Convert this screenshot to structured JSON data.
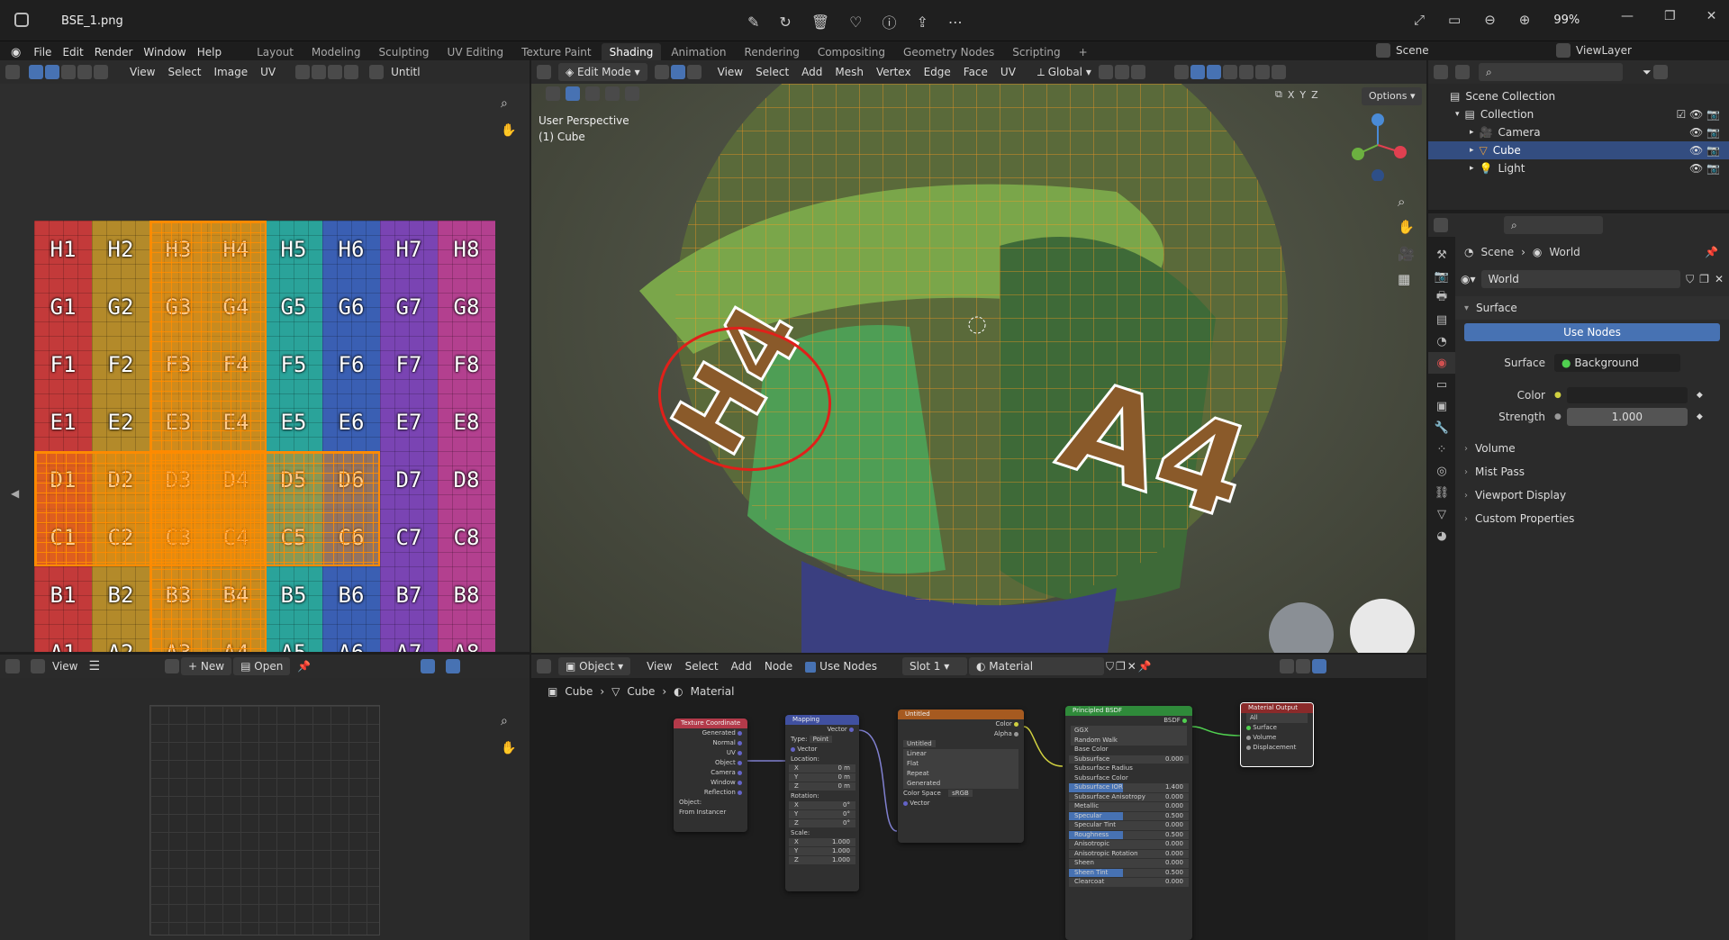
{
  "titlebar": {
    "filename": "BSE_1.png",
    "zoom": "99%"
  },
  "menu": {
    "items": [
      "File",
      "Edit",
      "Render",
      "Window",
      "Help"
    ],
    "workspaces": [
      "Layout",
      "Modeling",
      "Sculpting",
      "UV Editing",
      "Texture Paint",
      "Shading",
      "Animation",
      "Rendering",
      "Compositing",
      "Geometry Nodes",
      "Scripting"
    ],
    "active_workspace": "Shading",
    "scene_label": "Scene",
    "viewlayer_label": "ViewLayer"
  },
  "uv_editor": {
    "menu": [
      "View",
      "Select",
      "Image",
      "UV"
    ],
    "image_name": "Untitl",
    "rows": [
      [
        "H1",
        "H2",
        "H3",
        "H4",
        "H5",
        "H6",
        "H7",
        "H8"
      ],
      [
        "G1",
        "G2",
        "G3",
        "G4",
        "G5",
        "G6",
        "G7",
        "G8"
      ],
      [
        "F1",
        "F2",
        "F3",
        "F4",
        "F5",
        "F6",
        "F7",
        "F8"
      ],
      [
        "E1",
        "E2",
        "E3",
        "E4",
        "E5",
        "E6",
        "E7",
        "E8"
      ],
      [
        "D1",
        "D2",
        "D3",
        "D4",
        "D5",
        "D6",
        "D7",
        "D8"
      ],
      [
        "C1",
        "C2",
        "C3",
        "C4",
        "C5",
        "C6",
        "C7",
        "C8"
      ],
      [
        "B1",
        "B2",
        "B3",
        "B4",
        "B5",
        "B6",
        "B7",
        "B8"
      ],
      [
        "A1",
        "A2",
        "A3",
        "A4",
        "A5",
        "A6",
        "A7",
        "A8"
      ]
    ],
    "column_colors": [
      "#c33a3a",
      "#b38a2a",
      "#a98a33",
      "#9b8a3a",
      "#2aa39a",
      "#3a5fb3",
      "#7a44b3",
      "#b3408f"
    ]
  },
  "viewport": {
    "mode": "Edit Mode",
    "menu": [
      "View",
      "Select",
      "Add",
      "Mesh",
      "Vertex",
      "Edge",
      "Face",
      "UV"
    ],
    "orientation": "Global",
    "perspective": "User Perspective",
    "object": "(1) Cube",
    "options_label": "Options",
    "axes": [
      "X",
      "Y",
      "Z"
    ]
  },
  "image_editor": {
    "view_label": "View",
    "new_label": "New",
    "open_label": "Open"
  },
  "node_editor": {
    "mode": "Object",
    "menu": [
      "View",
      "Select",
      "Add",
      "Node"
    ],
    "use_nodes_label": "Use Nodes",
    "slot": "Slot 1",
    "material": "Material",
    "breadcrumb": [
      "Cube",
      "Cube",
      "Material"
    ],
    "nodes": {
      "texcoord": {
        "title": "Texture Coordinate",
        "outputs": [
          "Generated",
          "Normal",
          "UV",
          "Object",
          "Camera",
          "Window",
          "Reflection"
        ],
        "object_label": "Object:",
        "instancer": "From Instancer"
      },
      "mapping": {
        "title": "Mapping",
        "out": "Vector",
        "type_label": "Type:",
        "type_value": "Point",
        "vector": "Vector",
        "location": "Location:",
        "rotation": "Rotation:",
        "scale": "Scale:",
        "loc": [
          "0 m",
          "0 m",
          "0 m"
        ],
        "rot": [
          "0°",
          "0°",
          "0°"
        ],
        "scl": [
          "1.000",
          "1.000",
          "1.000"
        ],
        "axes": [
          "X",
          "Y",
          "Z"
        ]
      },
      "image": {
        "title": "Untitled",
        "outs": [
          "Color",
          "Alpha"
        ],
        "img": "Untitled",
        "opts": [
          "Linear",
          "Flat",
          "Repeat",
          "Generated"
        ],
        "cs_label": "Color Space",
        "cs_value": "sRGB",
        "vector": "Vector"
      },
      "bsdf": {
        "title": "Principled BSDF",
        "out": "BSDF",
        "dist": "GGX",
        "sss": "Random Walk",
        "rows": [
          [
            "Base Color",
            ""
          ],
          [
            "Subsurface",
            "0.000"
          ],
          [
            "Subsurface Radius",
            ""
          ],
          [
            "Subsurface Color",
            ""
          ],
          [
            "Subsurface IOR",
            "1.400"
          ],
          [
            "Subsurface Anisotropy",
            "0.000"
          ],
          [
            "Metallic",
            "0.000"
          ],
          [
            "Specular",
            "0.500"
          ],
          [
            "Specular Tint",
            "0.000"
          ],
          [
            "Roughness",
            "0.500"
          ],
          [
            "Anisotropic",
            "0.000"
          ],
          [
            "Anisotropic Rotation",
            "0.000"
          ],
          [
            "Sheen",
            "0.000"
          ],
          [
            "Sheen Tint",
            "0.500"
          ],
          [
            "Clearcoat",
            "0.000"
          ]
        ]
      },
      "output": {
        "title": "Material Output",
        "target": "All",
        "inputs": [
          "Surface",
          "Volume",
          "Displacement"
        ]
      }
    }
  },
  "outliner": {
    "root": "Scene Collection",
    "collection": "Collection",
    "items": [
      "Camera",
      "Cube",
      "Light"
    ]
  },
  "properties": {
    "breadcrumb": [
      "Scene",
      "World"
    ],
    "world_name": "World",
    "surface_section": "Surface",
    "use_nodes": "Use Nodes",
    "surface_label": "Surface",
    "surface_value": "Background",
    "color_label": "Color",
    "strength_label": "Strength",
    "strength_value": "1.000",
    "sections": [
      "Volume",
      "Mist Pass",
      "Viewport Display",
      "Custom Properties"
    ]
  }
}
